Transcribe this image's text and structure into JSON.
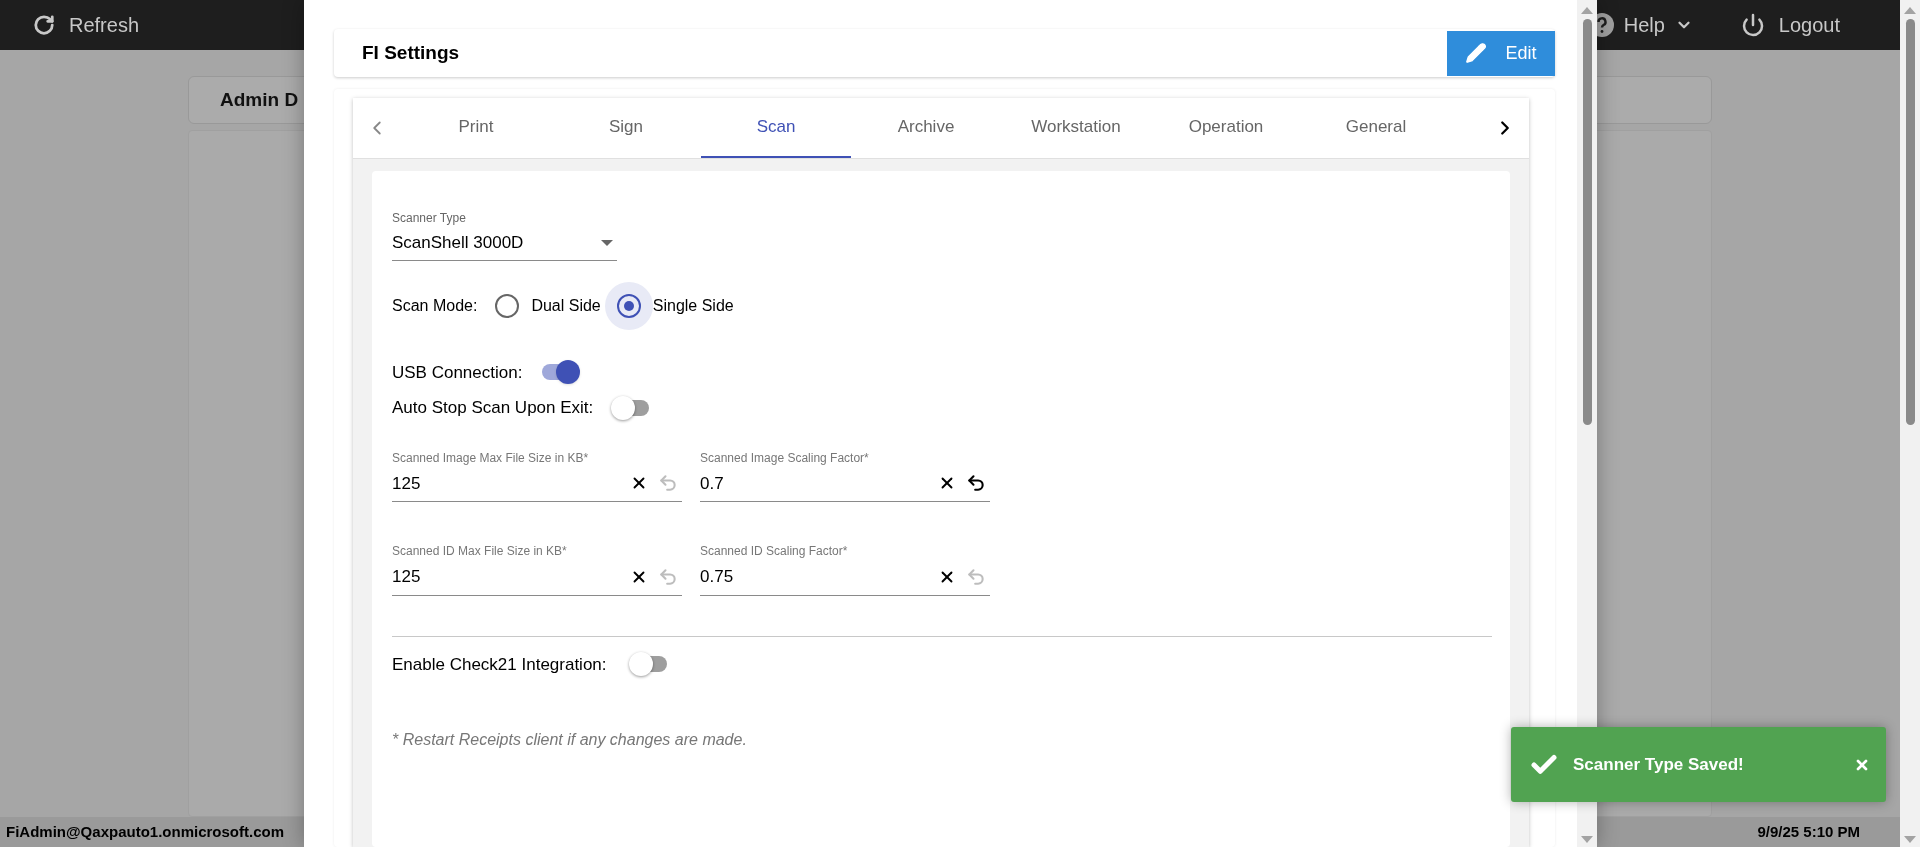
{
  "top_bar": {
    "refresh": "Refresh",
    "help": "Help",
    "logout": "Logout"
  },
  "background": {
    "card_title": "Admin D"
  },
  "footer": {
    "user": "FiAdmin@Qaxpauto1.onmicrosoft.com",
    "datetime": "9/9/25 5:10 PM"
  },
  "dialog": {
    "title": "FI Settings",
    "edit_button": "Edit",
    "tabs": [
      {
        "label": "Print",
        "selected": false
      },
      {
        "label": "Sign",
        "selected": false
      },
      {
        "label": "Scan",
        "selected": true
      },
      {
        "label": "Archive",
        "selected": false
      },
      {
        "label": "Workstation",
        "selected": false
      },
      {
        "label": "Operation",
        "selected": false
      },
      {
        "label": "General",
        "selected": false
      }
    ],
    "scanner_type": {
      "label": "Scanner Type",
      "value": "ScanShell 3000D"
    },
    "scan_mode": {
      "label": "Scan Mode:",
      "options": [
        {
          "label": "Dual Side",
          "selected": false
        },
        {
          "label": "Single Side",
          "selected": true
        }
      ]
    },
    "toggles": [
      {
        "label": "USB Connection:",
        "on": true
      },
      {
        "label": "Auto Stop Scan Upon Exit:",
        "on": false
      }
    ],
    "fields": [
      {
        "label": "Scanned Image Max File Size in KB*",
        "value": "125",
        "undo_enabled": false
      },
      {
        "label": "Scanned Image Scaling Factor*",
        "value": "0.7",
        "undo_enabled": true
      },
      {
        "label": "Scanned ID Max File Size in KB*",
        "value": "125",
        "undo_enabled": false
      },
      {
        "label": "Scanned ID Scaling Factor*",
        "value": "0.75",
        "undo_enabled": false
      }
    ],
    "check21": {
      "label": "Enable Check21 Integration:",
      "on": false
    },
    "note": "* Restart Receipts client if any changes are made."
  },
  "toast": {
    "message": "Scanner Type Saved!"
  }
}
